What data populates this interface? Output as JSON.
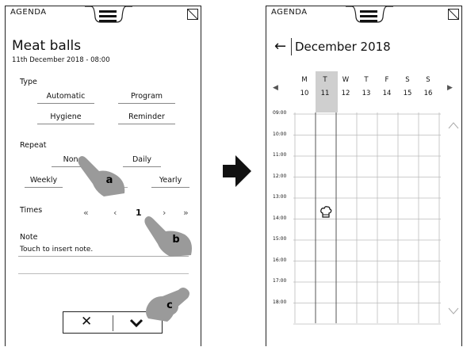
{
  "left_screen": {
    "app_title": "AGENDA",
    "event_title": "Meat balls",
    "event_date": "11th December 2018 - 08:00",
    "type": {
      "label": "Type",
      "options": [
        "Automatic",
        "Program",
        "Hygiene",
        "Reminder"
      ]
    },
    "repeat": {
      "label": "Repeat",
      "options": [
        "None",
        "Daily",
        "Weekly",
        "Yearly"
      ]
    },
    "times": {
      "label": "Times",
      "first": "«",
      "prev": "‹",
      "value": "1",
      "next": "›",
      "last": "»"
    },
    "note": {
      "label": "Note",
      "placeholder": "Touch to insert note."
    },
    "actions": {
      "cancel": "✕"
    }
  },
  "callouts": [
    "a",
    "b",
    "c"
  ],
  "right_screen": {
    "app_title": "AGENDA",
    "back": "←",
    "month": "December 2018",
    "nav_prev": "◀",
    "nav_next": "▶",
    "days": [
      {
        "name": "M",
        "num": "10"
      },
      {
        "name": "T",
        "num": "11"
      },
      {
        "name": "W",
        "num": "12"
      },
      {
        "name": "T",
        "num": "13"
      },
      {
        "name": "F",
        "num": "14"
      },
      {
        "name": "S",
        "num": "15"
      },
      {
        "name": "S",
        "num": "16"
      }
    ],
    "selected_day_index": 1,
    "times": [
      "09:00",
      "10:00",
      "11:00",
      "12:00",
      "13:00",
      "14:00",
      "15:00",
      "16:00",
      "17:00",
      "18:00"
    ],
    "event_icon": "chef-hat-icon"
  }
}
